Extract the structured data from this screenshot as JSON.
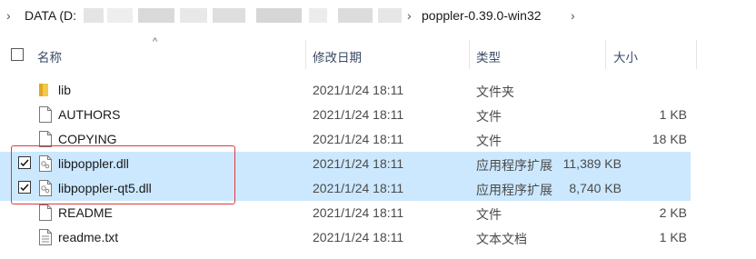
{
  "breadcrumb": {
    "chevron_left": "›",
    "drive": "DATA (D:",
    "folder": "poppler-0.39.0-win32",
    "chevron_sep": "›",
    "chevron_right": "›"
  },
  "header": {
    "col_name": "名称",
    "col_date": "修改日期",
    "col_type": "类型",
    "col_size": "大小",
    "sort_indicator": "^"
  },
  "files": [
    {
      "name": "lib",
      "date": "2021/1/24 18:11",
      "type": "文件夹",
      "size": "",
      "icon": "folder-icon",
      "selected": false
    },
    {
      "name": "AUTHORS",
      "date": "2021/1/24 18:11",
      "type": "文件",
      "size": "1 KB",
      "icon": "file-icon",
      "selected": false
    },
    {
      "name": "COPYING",
      "date": "2021/1/24 18:11",
      "type": "文件",
      "size": "18 KB",
      "icon": "file-icon",
      "selected": false
    },
    {
      "name": "libpoppler.dll",
      "date": "2021/1/24 18:11",
      "type": "应用程序扩展",
      "size": "11,389 KB",
      "icon": "dll-file-icon",
      "selected": true
    },
    {
      "name": "libpoppler-qt5.dll",
      "date": "2021/1/24 18:11",
      "type": "应用程序扩展",
      "size": "8,740 KB",
      "icon": "dll-file-icon",
      "selected": true
    },
    {
      "name": "README",
      "date": "2021/1/24 18:11",
      "type": "文件",
      "size": "2 KB",
      "icon": "file-icon",
      "selected": false
    },
    {
      "name": "readme.txt",
      "date": "2021/1/24 18:11",
      "type": "文本文档",
      "size": "1 KB",
      "icon": "text-file-icon",
      "selected": false
    }
  ],
  "colors": {
    "selection": "#cce8ff",
    "highlight_box": "#e0393e",
    "folder": "#f4c84a"
  }
}
